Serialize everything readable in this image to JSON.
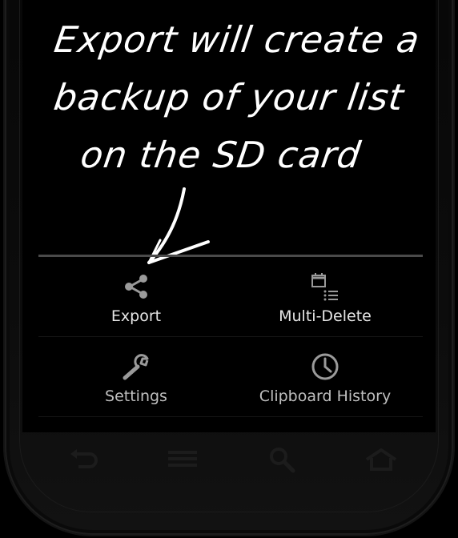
{
  "caption": {
    "line1": "Export will create a",
    "line2": "backup of your list",
    "line3": "on the SD card"
  },
  "menu": {
    "items": [
      {
        "label": "Export",
        "icon": "share-icon"
      },
      {
        "label": "Multi-Delete",
        "icon": "multi-delete-icon"
      },
      {
        "label": "Settings",
        "icon": "wrench-icon"
      },
      {
        "label": "Clipboard History",
        "icon": "clock-icon"
      }
    ]
  },
  "navbar": {
    "icons": [
      "back-icon",
      "menu-icon",
      "search-icon",
      "home-icon"
    ]
  },
  "colors": {
    "background": "#000000",
    "text": "#ffffff",
    "icon": "#9a9a9a",
    "divider": "#4a4a4a"
  }
}
